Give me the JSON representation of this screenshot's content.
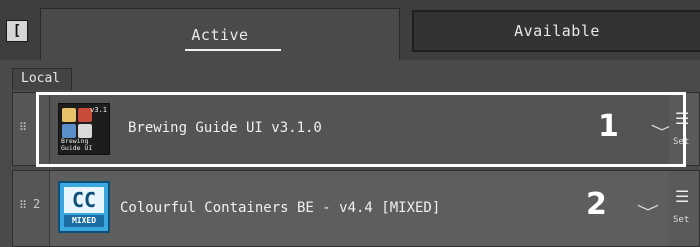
{
  "header": {
    "left_button_label": "[",
    "tabs": [
      {
        "label": "Active",
        "selected": true
      },
      {
        "label": "Available",
        "selected": false
      }
    ]
  },
  "section": {
    "label": "Local"
  },
  "packs": [
    {
      "handle": "⠿",
      "index": "",
      "icon_name": "brewing-guide-pack-icon",
      "icon_version": "v3.1",
      "icon_caption": "Brewing Guide UI",
      "name": "Brewing Guide UI v3.1.0",
      "annotation_number": "1",
      "expand_icon": "chevron-down-icon",
      "settings_icon": "settings-sliders-icon",
      "settings_label": "Set",
      "highlighted": true
    },
    {
      "handle": "⠿",
      "index": "2",
      "icon_name": "colourful-containers-pack-icon",
      "icon_logo": "CC",
      "icon_badge": "MIXED",
      "name": "Colourful Containers BE - v4.4 [MIXED]",
      "annotation_number": "2",
      "expand_icon": "chevron-down-icon",
      "settings_icon": "settings-sliders-icon",
      "settings_label": "Set",
      "highlighted": false
    }
  ],
  "colors": {
    "background": "#4a4a4a",
    "highlight_border": "#ffffff",
    "cc_icon_blue": "#3aa7e0"
  }
}
